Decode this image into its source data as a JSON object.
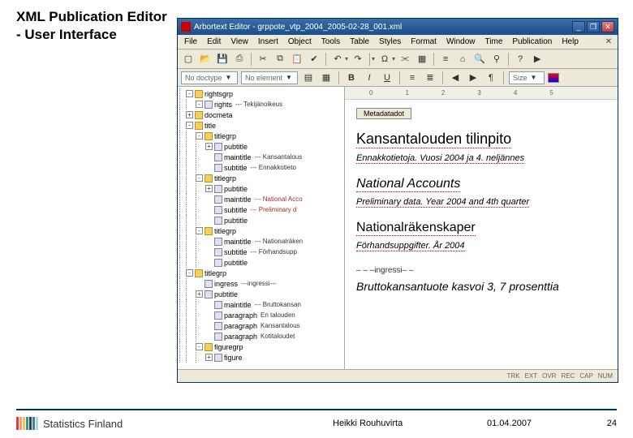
{
  "slide": {
    "title_line1": "XML Publication Editor",
    "title_line2": "- User Interface"
  },
  "window": {
    "title": "Arbortext Editor - grppote_vtp_2004_2005-02-28_001.xml"
  },
  "menu": [
    "File",
    "Edit",
    "View",
    "Insert",
    "Object",
    "Tools",
    "Table",
    "Styles",
    "Format",
    "Window",
    "Time",
    "Publication",
    "Help"
  ],
  "toolbar1_icons": [
    "new",
    "open",
    "save",
    "print",
    "cut",
    "copy",
    "paste",
    "spell",
    "undo",
    "redo",
    "omega",
    "link",
    "table",
    "ruler",
    "tag",
    "find",
    "zoom",
    "help",
    "play"
  ],
  "toolbar2": {
    "combo1": "No doctype",
    "combo2": "No element",
    "bold": "B",
    "italic": "I",
    "under": "U",
    "size_label": "Size"
  },
  "tree": [
    {
      "d": 1,
      "t": "-",
      "i": "f",
      "l": "rightsgrp"
    },
    {
      "d": 2,
      "t": "-",
      "i": "d",
      "l": "rights",
      "x": "--- Tekijänoikeus"
    },
    {
      "d": 1,
      "t": "+",
      "i": "f",
      "l": "docmeta"
    },
    {
      "d": 1,
      "t": "-",
      "i": "f",
      "l": "title"
    },
    {
      "d": 2,
      "t": "-",
      "i": "f",
      "l": "titlegrp"
    },
    {
      "d": 3,
      "t": "+",
      "i": "d",
      "l": "pubtitle"
    },
    {
      "d": 3,
      "t": " ",
      "i": "d",
      "l": "maintitle",
      "x": "--- Kansantalous"
    },
    {
      "d": 3,
      "t": " ",
      "i": "d",
      "l": "subtitle",
      "x": "--- Ennakkotieto"
    },
    {
      "d": 2,
      "t": "-",
      "i": "f",
      "l": "titlegrp"
    },
    {
      "d": 3,
      "t": "+",
      "i": "d",
      "l": "pubtitle"
    },
    {
      "d": 3,
      "t": " ",
      "i": "d",
      "l": "maintitle",
      "x": "--- National Acco",
      "red": true
    },
    {
      "d": 3,
      "t": " ",
      "i": "d",
      "l": "subtitle",
      "x": "--- Preliminary d",
      "red": true
    },
    {
      "d": 3,
      "t": " ",
      "i": "d",
      "l": "pubtitle"
    },
    {
      "d": 2,
      "t": "-",
      "i": "f",
      "l": "titlegrp"
    },
    {
      "d": 3,
      "t": " ",
      "i": "d",
      "l": "maintitle",
      "x": "--- Nationalräken"
    },
    {
      "d": 3,
      "t": " ",
      "i": "d",
      "l": "subtitle",
      "x": "--- Förhandsupp"
    },
    {
      "d": 3,
      "t": " ",
      "i": "d",
      "l": "pubtitle"
    },
    {
      "d": 1,
      "t": "-",
      "i": "f",
      "l": "titlegrp"
    },
    {
      "d": 2,
      "t": " ",
      "i": "d",
      "l": "ingress",
      "x": "---ingressi---"
    },
    {
      "d": 2,
      "t": "+",
      "i": "d",
      "l": "pubtitle"
    },
    {
      "d": 3,
      "t": " ",
      "i": "d",
      "l": "maintitle",
      "x": "--- Bruttokansan"
    },
    {
      "d": 3,
      "t": " ",
      "i": "d",
      "l": "paragraph",
      "x": "En   talouden"
    },
    {
      "d": 3,
      "t": " ",
      "i": "d",
      "l": "paragraph",
      "x": "Kansantalous"
    },
    {
      "d": 3,
      "t": " ",
      "i": "d",
      "l": "paragraph",
      "x": "Kotitaloudet"
    },
    {
      "d": 2,
      "t": "-",
      "i": "f",
      "l": "figuregrp"
    },
    {
      "d": 3,
      "t": "+",
      "i": "d",
      "l": "figure"
    }
  ],
  "ruler_marks": [
    "0",
    "1",
    "2",
    "3",
    "4",
    "5"
  ],
  "doc": {
    "meta_btn": "Metadatadot",
    "h_fi": "Kansantalouden tilinpito",
    "s_fi": "Ennakkotietoja. Vuosi 2004 ja 4. neljännes",
    "h_en": "National Accounts",
    "s_en": "Preliminary data. Year 2004 and 4th quarter",
    "h_sv": "Nationalräkenskaper",
    "s_sv_a": "Förhandsuppgifter. År",
    "s_sv_b": "2004",
    "ingr": "– – –ingressi– –",
    "para": "Bruttokansantuote kasvoi 3, 7 prosenttia"
  },
  "status": [
    "TRK",
    "EXT",
    "OVR",
    "REC",
    "CAP",
    "NUM"
  ],
  "footer": {
    "brand": "Statistics Finland",
    "author": "Heikki Rouhuvirta",
    "date": "01.04.2007",
    "page": "24"
  },
  "logo_colors": [
    "#e63946",
    "#f4a261",
    "#e9c46a",
    "#2a9d8f",
    "#264653",
    "#457b9d",
    "#a8dadc"
  ]
}
